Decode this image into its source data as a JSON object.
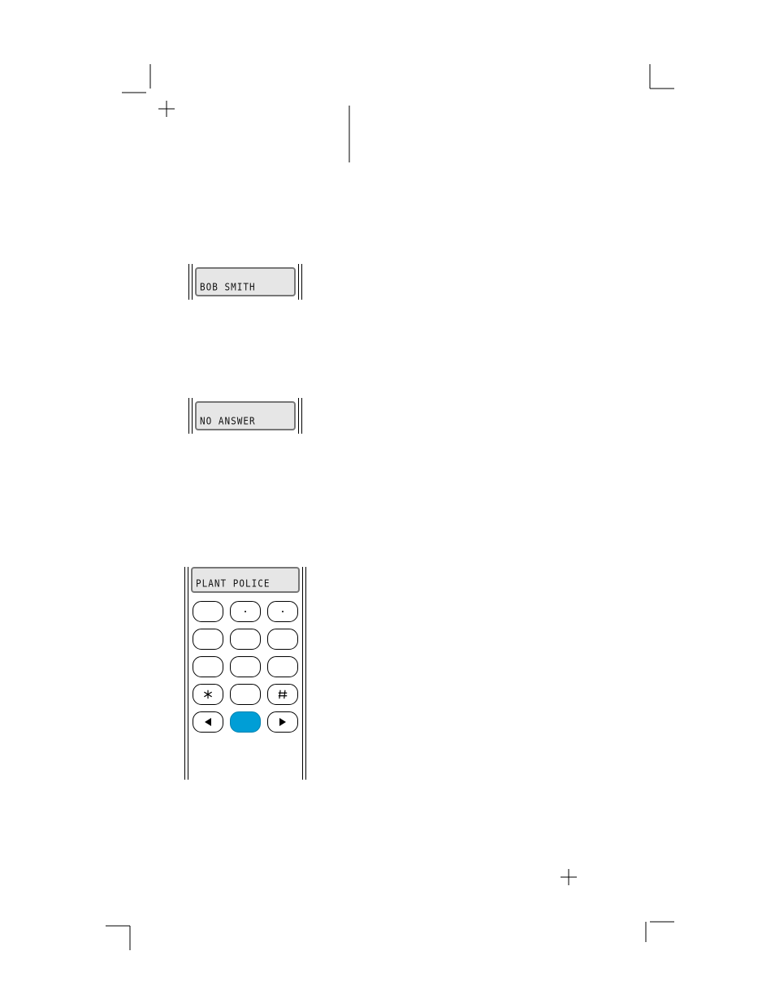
{
  "lcd1": {
    "text": "BOB SMITH"
  },
  "lcd2": {
    "text": "NO ANSWER"
  },
  "keypad": {
    "screen_text": "PLANT POLICE",
    "keys": {
      "k1": "",
      "k2": "",
      "k3": "",
      "k4": "",
      "k5": "",
      "k6": "",
      "k7": "",
      "k8": "",
      "k9": "",
      "star": "*",
      "k0": "",
      "hash": "#",
      "left": "◀",
      "ptt": "",
      "right": "▶"
    }
  },
  "colors": {
    "lcd_bg": "#e6e6e6",
    "ptt_blue": "#009ed6"
  }
}
